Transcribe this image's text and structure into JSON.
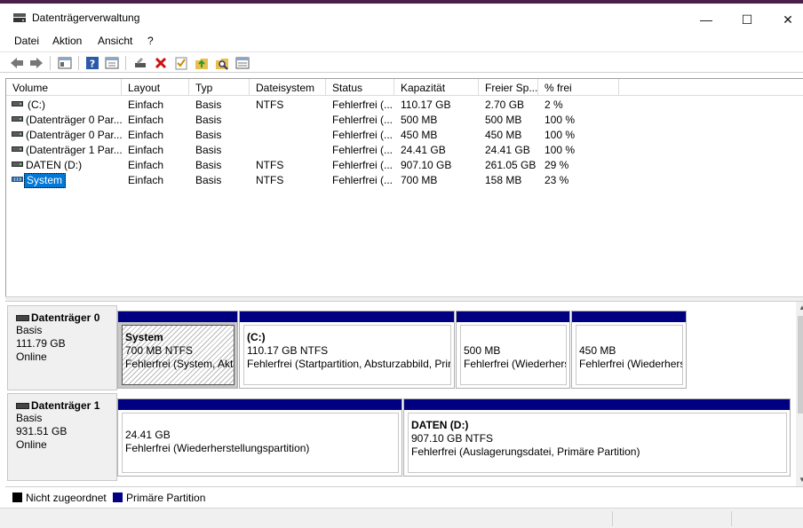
{
  "window": {
    "title": "Datenträgerverwaltung",
    "minimize": "—",
    "maximize": "☐",
    "close": "✕"
  },
  "menu": [
    "Datei",
    "Aktion",
    "Ansicht",
    "?"
  ],
  "toolbar": [
    "back-icon",
    "forward-icon",
    "show-hide-console-tree-icon",
    "help-icon",
    "properties-icon",
    "connect-disk-icon",
    "delete-icon",
    "check-icon",
    "open-folder-icon",
    "explore-icon",
    "list-view-icon"
  ],
  "volumes": {
    "headers": [
      "Volume",
      "Layout",
      "Typ",
      "Dateisystem",
      "Status",
      "Kapazität",
      "Freier Sp...",
      "% frei"
    ],
    "rows": [
      {
        "volume": "(C:)",
        "layout": "Einfach",
        "typ": "Basis",
        "fs": "NTFS",
        "status": "Fehlerfrei (...",
        "capacity": "110.17 GB",
        "free": "2.70 GB",
        "pct": "2 %"
      },
      {
        "volume": "(Datenträger 0 Par...",
        "layout": "Einfach",
        "typ": "Basis",
        "fs": "",
        "status": "Fehlerfrei (...",
        "capacity": "500 MB",
        "free": "500 MB",
        "pct": "100 %"
      },
      {
        "volume": "(Datenträger 0 Par...",
        "layout": "Einfach",
        "typ": "Basis",
        "fs": "",
        "status": "Fehlerfrei (...",
        "capacity": "450 MB",
        "free": "450 MB",
        "pct": "100 %"
      },
      {
        "volume": "(Datenträger 1 Par...",
        "layout": "Einfach",
        "typ": "Basis",
        "fs": "",
        "status": "Fehlerfrei (...",
        "capacity": "24.41 GB",
        "free": "24.41 GB",
        "pct": "100 %"
      },
      {
        "volume": "DATEN (D:)",
        "layout": "Einfach",
        "typ": "Basis",
        "fs": "NTFS",
        "status": "Fehlerfrei (...",
        "capacity": "907.10 GB",
        "free": "261.05 GB",
        "pct": "29 %"
      },
      {
        "volume": "System",
        "layout": "Einfach",
        "typ": "Basis",
        "fs": "NTFS",
        "status": "Fehlerfrei (...",
        "capacity": "700 MB",
        "free": "158 MB",
        "pct": "23 %"
      }
    ]
  },
  "disks": [
    {
      "name": "Datenträger 0",
      "type": "Basis",
      "size": "111.79 GB",
      "state": "Online",
      "partitions": [
        {
          "title": "System",
          "size": "700 MB NTFS",
          "status": "Fehlerfrei (System, Akti"
        },
        {
          "title": "(C:)",
          "size": "110.17 GB NTFS",
          "status": "Fehlerfrei (Startpartition, Absturzabbild, Prir"
        },
        {
          "title": "",
          "size": "500 MB",
          "status": "Fehlerfrei (Wiederhers"
        },
        {
          "title": "",
          "size": "450 MB",
          "status": "Fehlerfrei (Wiederhers"
        }
      ]
    },
    {
      "name": "Datenträger 1",
      "type": "Basis",
      "size": "931.51 GB",
      "state": "Online",
      "partitions": [
        {
          "title": "",
          "size": "24.41 GB",
          "status": "Fehlerfrei (Wiederherstellungspartition)"
        },
        {
          "title": "DATEN  (D:)",
          "size": "907.10 GB NTFS",
          "status": "Fehlerfrei (Auslagerungsdatei, Primäre Partition)"
        }
      ]
    }
  ],
  "legend": [
    {
      "label": "Nicht zugeordnet",
      "color": "#000000"
    },
    {
      "label": "Primäre Partition",
      "color": "#000080"
    }
  ]
}
